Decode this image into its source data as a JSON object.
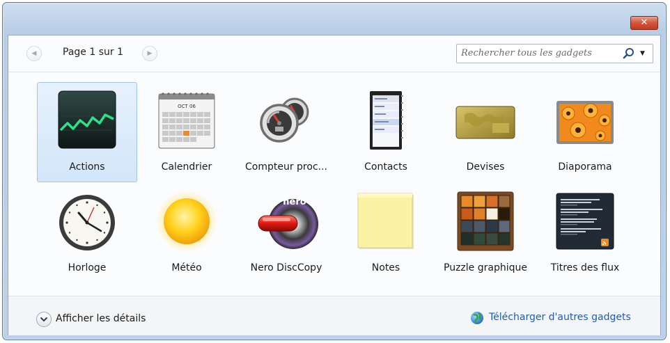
{
  "window": {
    "close_label": "✕"
  },
  "toolbar": {
    "prev_icon": "◀",
    "next_icon": "▶",
    "page_text": "Page 1 sur 1",
    "search_placeholder": "Rechercher tous les gadgets",
    "search_dropdown": "▼"
  },
  "gadgets": [
    {
      "label": "Actions",
      "icon": "stock-chart-icon",
      "selected": true
    },
    {
      "label": "Calendrier",
      "icon": "calendar-icon"
    },
    {
      "label": "Compteur proc...",
      "icon": "cpu-meter-icon"
    },
    {
      "label": "Contacts",
      "icon": "contacts-icon"
    },
    {
      "label": "Devises",
      "icon": "currency-icon"
    },
    {
      "label": "Diaporama",
      "icon": "slideshow-icon"
    },
    {
      "label": "Horloge",
      "icon": "clock-icon"
    },
    {
      "label": "Météo",
      "icon": "weather-sun-icon"
    },
    {
      "label": "Nero DiscCopy",
      "icon": "nero-disc-icon"
    },
    {
      "label": "Notes",
      "icon": "sticky-note-icon"
    },
    {
      "label": "Puzzle graphique",
      "icon": "picture-puzzle-icon"
    },
    {
      "label": "Titres des flux",
      "icon": "feed-headlines-icon"
    }
  ],
  "icon_text": {
    "calendar_month": "OCT 06",
    "nero_logo": "nero"
  },
  "footer": {
    "details_label": "Afficher les détails",
    "download_link": "Télécharger d'autres gadgets"
  },
  "colors": {
    "selection": "#d3e6fa",
    "link": "#1b5fb5",
    "close": "#c23a1f"
  }
}
